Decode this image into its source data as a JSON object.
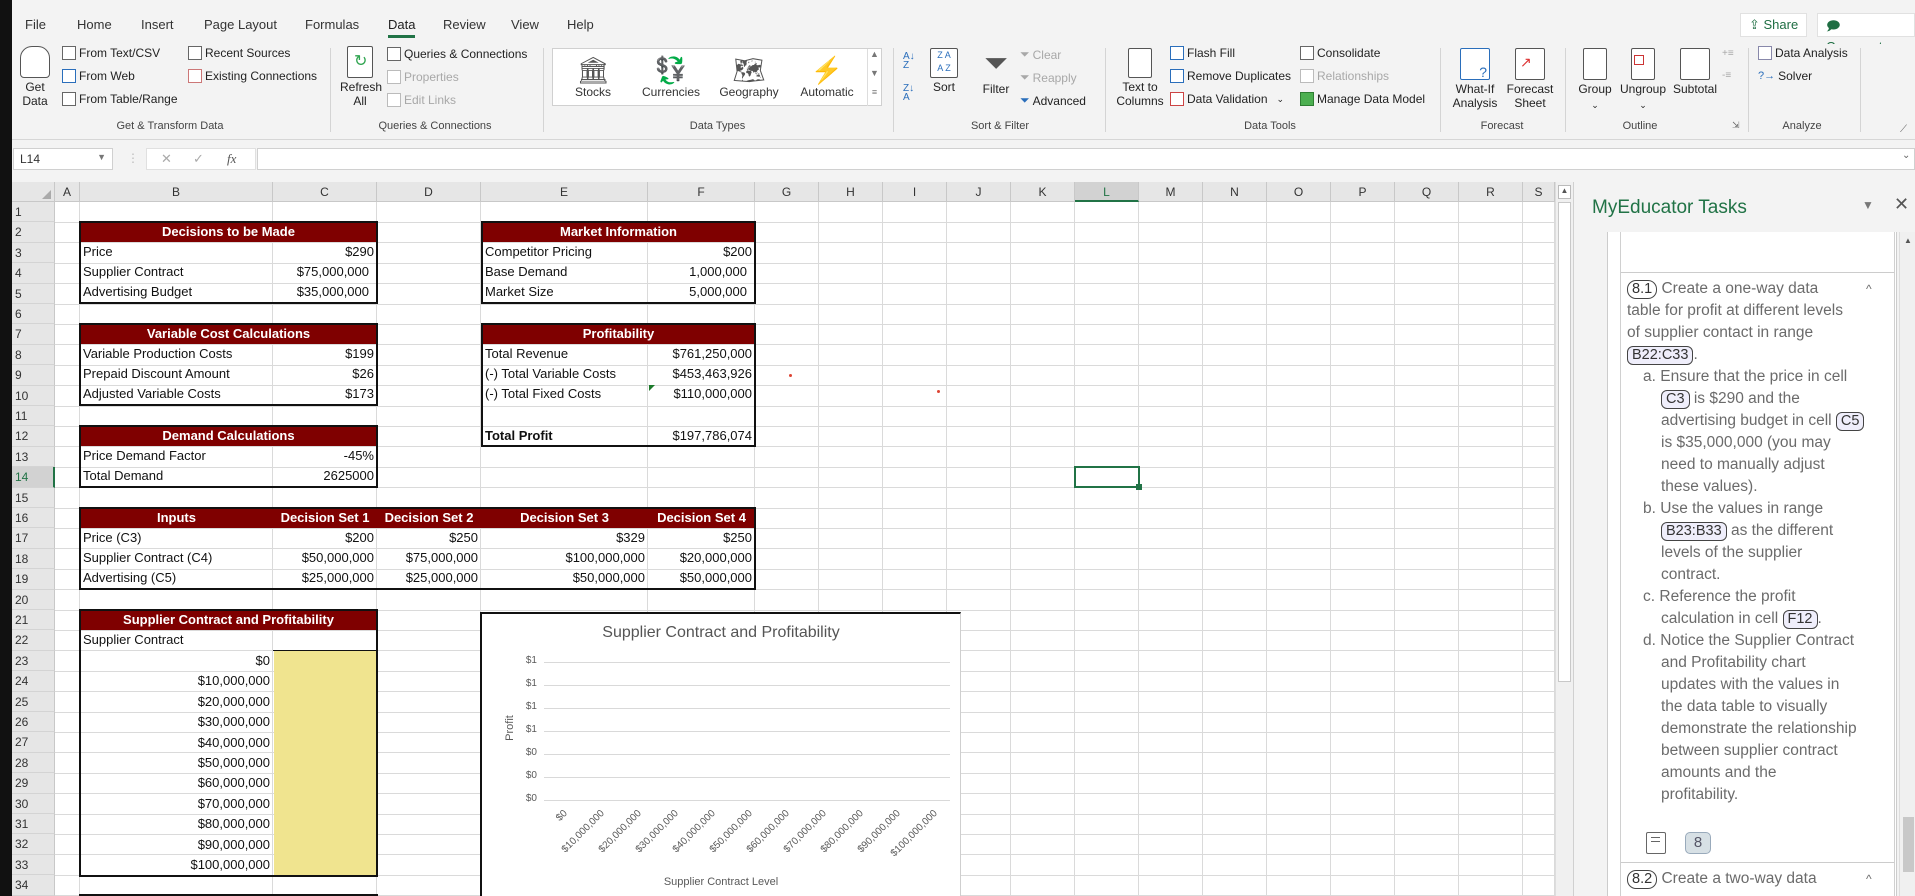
{
  "ribbon": {
    "tabs": [
      "File",
      "Home",
      "Insert",
      "Page Layout",
      "Formulas",
      "Data",
      "Review",
      "View",
      "Help"
    ],
    "active_tab": "Data",
    "share_label": "Share",
    "comments_label": "Comments",
    "groups": {
      "get_transform": {
        "label": "Get & Transform Data",
        "get_data": "Get Data",
        "from_text_csv": "From Text/CSV",
        "from_web": "From Web",
        "from_table_range": "From Table/Range",
        "recent_sources": "Recent Sources",
        "existing_connections": "Existing Connections"
      },
      "queries": {
        "label": "Queries & Connections",
        "refresh_all": "Refresh All",
        "queries_connections": "Queries & Connections",
        "properties": "Properties",
        "edit_links": "Edit Links"
      },
      "data_types": {
        "label": "Data Types",
        "items": [
          "Stocks",
          "Currencies",
          "Geography",
          "Automatic"
        ]
      },
      "sort_filter": {
        "label": "Sort & Filter",
        "sort": "Sort",
        "filter": "Filter",
        "clear": "Clear",
        "reapply": "Reapply",
        "advanced": "Advanced"
      },
      "data_tools": {
        "label": "Data Tools",
        "text_to_columns": "Text to Columns",
        "flash_fill": "Flash Fill",
        "remove_duplicates": "Remove Duplicates",
        "data_validation": "Data Validation",
        "consolidate": "Consolidate",
        "relationships": "Relationships",
        "manage_data_model": "Manage Data Model"
      },
      "forecast": {
        "label": "Forecast",
        "what_if": "What-If Analysis",
        "forecast_sheet": "Forecast Sheet"
      },
      "outline": {
        "label": "Outline",
        "group": "Group",
        "ungroup": "Ungroup",
        "subtotal": "Subtotal"
      },
      "analyze": {
        "label": "Analyze",
        "data_analysis": "Data Analysis",
        "solver": "Solver"
      }
    }
  },
  "formula_bar": {
    "name_box": "L14",
    "cancel": "✕",
    "enter": "✓",
    "fx": "fx",
    "formula": ""
  },
  "sheet": {
    "columns": [
      "A",
      "B",
      "C",
      "D",
      "E",
      "F",
      "G",
      "H",
      "I",
      "J",
      "K",
      "L",
      "M",
      "N",
      "O",
      "P",
      "Q",
      "R",
      "S"
    ],
    "selected_column": "L",
    "selected_row": 14,
    "rows": [
      1,
      2,
      3,
      4,
      5,
      6,
      7,
      8,
      9,
      10,
      11,
      12,
      13,
      14,
      15,
      16,
      17,
      18,
      19,
      20,
      21,
      22,
      23,
      24,
      25,
      26,
      27,
      28,
      29,
      30,
      31,
      32,
      33,
      34
    ],
    "decisions": {
      "title": "Decisions to be Made",
      "rows": [
        {
          "label": "Price",
          "value": "$290"
        },
        {
          "label": "Supplier Contract",
          "value": "$75,000,000"
        },
        {
          "label": "Advertising Budget",
          "value": "$35,000,000"
        }
      ]
    },
    "variable_costs": {
      "title": "Variable Cost Calculations",
      "rows": [
        {
          "label": "Variable Production Costs",
          "value": "$199"
        },
        {
          "label": "Prepaid Discount Amount",
          "value": "$26"
        },
        {
          "label": "Adjusted Variable Costs",
          "value": "$173"
        }
      ]
    },
    "demand": {
      "title": "Demand Calculations",
      "rows": [
        {
          "label": "Price Demand Factor",
          "value": "-45%"
        },
        {
          "label": "Total Demand",
          "value": "2625000"
        }
      ]
    },
    "market": {
      "title": "Market Information",
      "rows": [
        {
          "label": "Competitor Pricing",
          "value": "$200"
        },
        {
          "label": "Base Demand",
          "value": "1,000,000"
        },
        {
          "label": "Market Size",
          "value": "5,000,000"
        }
      ]
    },
    "profitability": {
      "title": "Profitability",
      "rows": [
        {
          "label": "Total Revenue",
          "value": "$761,250,000"
        },
        {
          "label": "(-) Total Variable Costs",
          "value": "$453,463,926"
        },
        {
          "label": "(-) Total Fixed Costs",
          "value": "$110,000,000"
        }
      ],
      "total_label": "Total Profit",
      "total_value": "$197,786,074"
    },
    "inputs": {
      "headers": [
        "Inputs",
        "Decision Set 1",
        "Decision Set 2",
        "Decision Set 3",
        "Decision Set 4"
      ],
      "rows": [
        {
          "label": "Price (C3)",
          "values": [
            "$200",
            "$250",
            "$329",
            "$250"
          ]
        },
        {
          "label": "Supplier Contract (C4)",
          "values": [
            "$50,000,000",
            "$75,000,000",
            "$100,000,000",
            "$20,000,000"
          ]
        },
        {
          "label": "Advertising (C5)",
          "values": [
            "$25,000,000",
            "$25,000,000",
            "$50,000,000",
            "$50,000,000"
          ]
        }
      ]
    },
    "supplier_table": {
      "title": "Supplier Contract and Profitability",
      "subheader": "Supplier Contract",
      "levels": [
        "$0",
        "$10,000,000",
        "$20,000,000",
        "$30,000,000",
        "$40,000,000",
        "$50,000,000",
        "$60,000,000",
        "$70,000,000",
        "$80,000,000",
        "$90,000,000",
        "$100,000,000"
      ]
    }
  },
  "chart_data": {
    "type": "line",
    "title": "Supplier Contract and Profitability",
    "xlabel": "Supplier Contract Level",
    "ylabel": "Profit",
    "categories": [
      "$0",
      "$10,000,000",
      "$20,000,000",
      "$30,000,000",
      "$40,000,000",
      "$50,000,000",
      "$60,000,000",
      "$70,000,000",
      "$80,000,000",
      "$90,000,000",
      "$100,000,000"
    ],
    "series": [
      {
        "name": "Profit",
        "values": []
      }
    ],
    "y_tick_labels": [
      "$1",
      "$1",
      "$1",
      "$1",
      "$0",
      "$0",
      "$0"
    ],
    "ylim": [
      0,
      1
    ],
    "grid": true,
    "legend": "none"
  },
  "task_pane": {
    "title": "MyEducator Tasks",
    "task_8_1": {
      "number": "8.1",
      "lines": [
        "Create a one-way data",
        "table for profit at different levels",
        "of supplier contact in range"
      ],
      "range_ref": "B22:C33",
      "steps": [
        {
          "marker": "a.",
          "lines": [
            "Ensure that the price in cell",
            "is $290 and the",
            "advertising budget in cell",
            "is $35,000,000 (you may",
            "need to manually adjust",
            "these values)."
          ],
          "refs": [
            "C3",
            "C5"
          ]
        },
        {
          "marker": "b.",
          "lines": [
            "Use the values in range",
            "as the different",
            "levels of the supplier",
            "contract."
          ],
          "refs": [
            "B23:B33"
          ]
        },
        {
          "marker": "c.",
          "lines": [
            "Reference the profit",
            "calculation in cell"
          ],
          "refs": [
            "F12"
          ]
        },
        {
          "marker": "d.",
          "lines": [
            "Notice the Supplier Contract",
            "and Profitability chart",
            "updates with the values in",
            "the data table to visually",
            "demonstrate the relationship",
            "between supplier contract",
            "amounts and the",
            "profitability."
          ]
        }
      ],
      "badge": "8"
    },
    "task_8_2": {
      "number": "8.2",
      "text": "Create a two-way data"
    }
  }
}
